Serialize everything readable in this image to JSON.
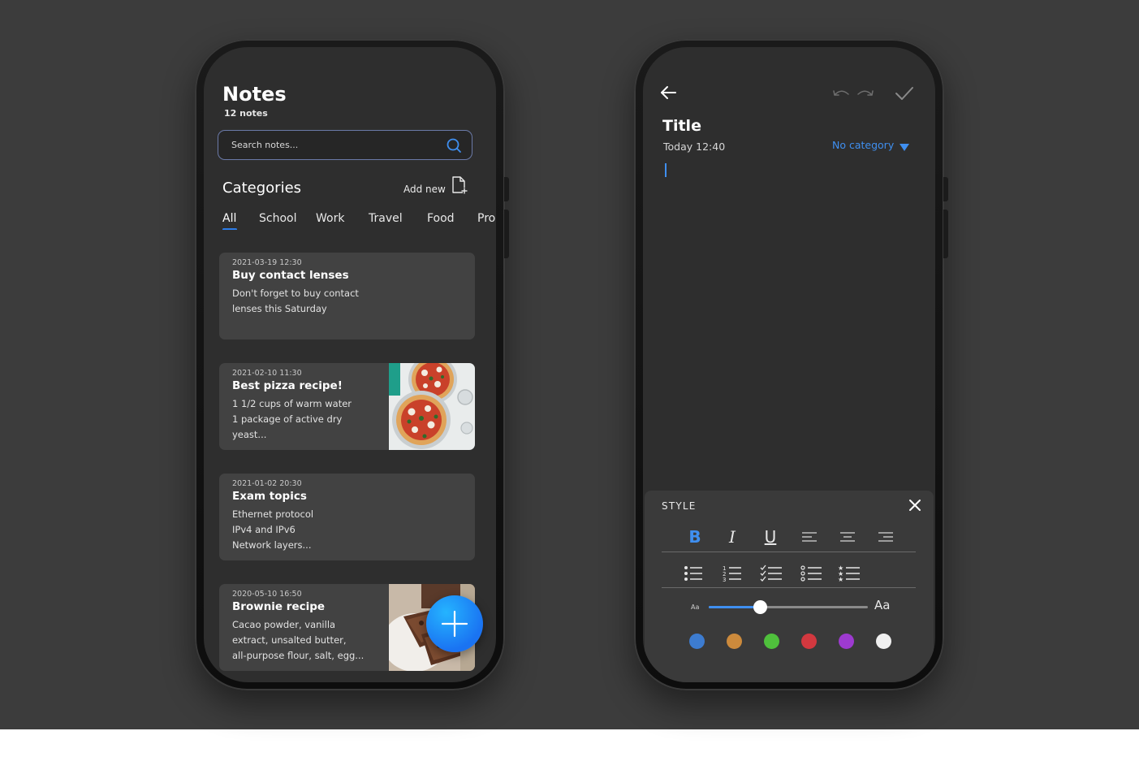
{
  "notes_screen": {
    "title": "Notes",
    "count": "12 notes",
    "search_placeholder": "Search notes...",
    "categories_title": "Categories",
    "add_new_label": "Add new",
    "tabs": [
      "All",
      "School",
      "Work",
      "Travel",
      "Food",
      "Pro"
    ],
    "active_tab": "All",
    "notes": [
      {
        "date": "2021-03-19 12:30",
        "title": "Buy contact lenses",
        "body": "Don't forget to buy contact\nlenses this Saturday",
        "image": "none"
      },
      {
        "date": "2021-02-10 11:30",
        "title": "Best pizza recipe!",
        "body": "1 1/2 cups of warm water\n1 package of active dry\nyeast...",
        "image": "pizza-photo"
      },
      {
        "date": "2021-01-02 20:30",
        "title": "Exam topics",
        "body": "Ethernet protocol\nIPv4 and IPv6\nNetwork layers...",
        "image": "none"
      },
      {
        "date": "2020-05-10 16:50",
        "title": "Brownie recipe",
        "body": "Cacao powder, vanilla\nextract, unsalted butter,\nall-purpose flour, salt, egg...",
        "image": "brownie-photo"
      }
    ],
    "fab_icon": "plus-icon"
  },
  "editor_screen": {
    "title": "Title",
    "date": "Today 12:40",
    "category_label": "No category",
    "style_panel": {
      "label": "STYLE",
      "format_buttons": [
        "bold",
        "italic",
        "underline",
        "align-left",
        "align-center",
        "align-right"
      ],
      "list_buttons": [
        "bullet-list",
        "numbered-list",
        "checklist",
        "circle-list",
        "star-list"
      ],
      "font_size_small": "Aa",
      "font_size_large": "Aa",
      "font_size_level": 0.32,
      "colors": [
        "#3d7cd0",
        "#cc8a3c",
        "#4fc03c",
        "#d2383f",
        "#9d3ad0",
        "#f0f0f0"
      ]
    }
  },
  "colors": {
    "accent": "#3f8ff0",
    "background": "#3c3c3c",
    "screen": "#2e2e2e",
    "card": "#424242"
  }
}
